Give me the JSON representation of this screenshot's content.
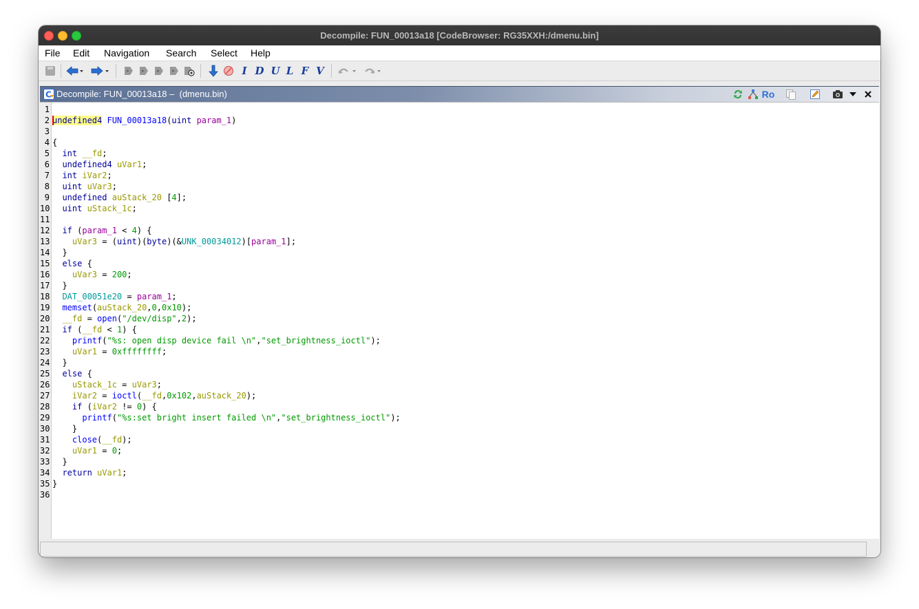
{
  "window": {
    "title": "Decompile: FUN_00013a18 [CodeBrowser: RG35XXH:/dmenu.bin]"
  },
  "menu": {
    "items": [
      "File",
      "Edit",
      "Navigation",
      "Search",
      "Select",
      "Help"
    ]
  },
  "toolbar": {
    "letters": [
      "I",
      "D",
      "U",
      "L",
      "F",
      "V"
    ]
  },
  "panel": {
    "title": "Decompile: FUN_00013a18 –  (dmenu.bin)",
    "ro_label": "Ro"
  },
  "colors": {
    "keyword": "#000099",
    "type": "#000099",
    "function": "#0000ff",
    "variable": "#999900",
    "param": "#990099",
    "global": "#009999",
    "number": "#009900",
    "string": "#009900",
    "default": "#000000"
  },
  "code": {
    "lines": [
      {
        "n": "1",
        "t": []
      },
      {
        "n": "2",
        "t": [
          {
            "s": "undefined4",
            "c": "type",
            "hl": true
          },
          {
            "s": " "
          },
          {
            "s": "FUN_00013a18",
            "c": "function"
          },
          {
            "s": "("
          },
          {
            "s": "uint",
            "c": "type"
          },
          {
            "s": " "
          },
          {
            "s": "param_1",
            "c": "param"
          },
          {
            "s": ")"
          }
        ]
      },
      {
        "n": "3",
        "t": []
      },
      {
        "n": "4",
        "t": [
          {
            "s": "{"
          }
        ]
      },
      {
        "n": "5",
        "t": [
          {
            "s": "  "
          },
          {
            "s": "int",
            "c": "type"
          },
          {
            "s": " "
          },
          {
            "s": "__fd",
            "c": "variable"
          },
          {
            "s": ";"
          }
        ]
      },
      {
        "n": "6",
        "t": [
          {
            "s": "  "
          },
          {
            "s": "undefined4",
            "c": "type"
          },
          {
            "s": " "
          },
          {
            "s": "uVar1",
            "c": "variable"
          },
          {
            "s": ";"
          }
        ]
      },
      {
        "n": "7",
        "t": [
          {
            "s": "  "
          },
          {
            "s": "int",
            "c": "type"
          },
          {
            "s": " "
          },
          {
            "s": "iVar2",
            "c": "variable"
          },
          {
            "s": ";"
          }
        ]
      },
      {
        "n": "8",
        "t": [
          {
            "s": "  "
          },
          {
            "s": "uint",
            "c": "type"
          },
          {
            "s": " "
          },
          {
            "s": "uVar3",
            "c": "variable"
          },
          {
            "s": ";"
          }
        ]
      },
      {
        "n": "9",
        "t": [
          {
            "s": "  "
          },
          {
            "s": "undefined",
            "c": "type"
          },
          {
            "s": " "
          },
          {
            "s": "auStack_20",
            "c": "variable"
          },
          {
            "s": " ["
          },
          {
            "s": "4",
            "c": "number"
          },
          {
            "s": "];"
          }
        ]
      },
      {
        "n": "10",
        "t": [
          {
            "s": "  "
          },
          {
            "s": "uint",
            "c": "type"
          },
          {
            "s": " "
          },
          {
            "s": "uStack_1c",
            "c": "variable"
          },
          {
            "s": ";"
          }
        ]
      },
      {
        "n": "11",
        "t": []
      },
      {
        "n": "12",
        "t": [
          {
            "s": "  "
          },
          {
            "s": "if",
            "c": "keyword"
          },
          {
            "s": " ("
          },
          {
            "s": "param_1",
            "c": "param"
          },
          {
            "s": " < "
          },
          {
            "s": "4",
            "c": "number"
          },
          {
            "s": ") {"
          }
        ]
      },
      {
        "n": "13",
        "t": [
          {
            "s": "    "
          },
          {
            "s": "uVar3",
            "c": "variable"
          },
          {
            "s": " = ("
          },
          {
            "s": "uint",
            "c": "type"
          },
          {
            "s": ")("
          },
          {
            "s": "byte",
            "c": "type"
          },
          {
            "s": ")(&"
          },
          {
            "s": "UNK_00034012",
            "c": "global"
          },
          {
            "s": ")["
          },
          {
            "s": "param_1",
            "c": "param"
          },
          {
            "s": "];"
          }
        ]
      },
      {
        "n": "14",
        "t": [
          {
            "s": "  }"
          }
        ]
      },
      {
        "n": "15",
        "t": [
          {
            "s": "  "
          },
          {
            "s": "else",
            "c": "keyword"
          },
          {
            "s": " {"
          }
        ]
      },
      {
        "n": "16",
        "t": [
          {
            "s": "    "
          },
          {
            "s": "uVar3",
            "c": "variable"
          },
          {
            "s": " = "
          },
          {
            "s": "200",
            "c": "number"
          },
          {
            "s": ";"
          }
        ]
      },
      {
        "n": "17",
        "t": [
          {
            "s": "  }"
          }
        ]
      },
      {
        "n": "18",
        "t": [
          {
            "s": "  "
          },
          {
            "s": "DAT_00051e20",
            "c": "global"
          },
          {
            "s": " = "
          },
          {
            "s": "param_1",
            "c": "param"
          },
          {
            "s": ";"
          }
        ]
      },
      {
        "n": "19",
        "t": [
          {
            "s": "  "
          },
          {
            "s": "memset",
            "c": "function"
          },
          {
            "s": "("
          },
          {
            "s": "auStack_20",
            "c": "variable"
          },
          {
            "s": ","
          },
          {
            "s": "0",
            "c": "number"
          },
          {
            "s": ","
          },
          {
            "s": "0x10",
            "c": "number"
          },
          {
            "s": ");"
          }
        ]
      },
      {
        "n": "20",
        "t": [
          {
            "s": "  "
          },
          {
            "s": "__fd",
            "c": "variable"
          },
          {
            "s": " = "
          },
          {
            "s": "open",
            "c": "function"
          },
          {
            "s": "("
          },
          {
            "s": "\"/dev/disp\"",
            "c": "string"
          },
          {
            "s": ","
          },
          {
            "s": "2",
            "c": "number"
          },
          {
            "s": ");"
          }
        ]
      },
      {
        "n": "21",
        "t": [
          {
            "s": "  "
          },
          {
            "s": "if",
            "c": "keyword"
          },
          {
            "s": " ("
          },
          {
            "s": "__fd",
            "c": "variable"
          },
          {
            "s": " < "
          },
          {
            "s": "1",
            "c": "number"
          },
          {
            "s": ") {"
          }
        ]
      },
      {
        "n": "22",
        "t": [
          {
            "s": "    "
          },
          {
            "s": "printf",
            "c": "function"
          },
          {
            "s": "("
          },
          {
            "s": "\"%s: open disp device fail \\n\"",
            "c": "string"
          },
          {
            "s": ","
          },
          {
            "s": "\"set_brightness_ioctl\"",
            "c": "string"
          },
          {
            "s": ");"
          }
        ]
      },
      {
        "n": "23",
        "t": [
          {
            "s": "    "
          },
          {
            "s": "uVar1",
            "c": "variable"
          },
          {
            "s": " = "
          },
          {
            "s": "0xffffffff",
            "c": "number"
          },
          {
            "s": ";"
          }
        ]
      },
      {
        "n": "24",
        "t": [
          {
            "s": "  }"
          }
        ]
      },
      {
        "n": "25",
        "t": [
          {
            "s": "  "
          },
          {
            "s": "else",
            "c": "keyword"
          },
          {
            "s": " {"
          }
        ]
      },
      {
        "n": "26",
        "t": [
          {
            "s": "    "
          },
          {
            "s": "uStack_1c",
            "c": "variable"
          },
          {
            "s": " = "
          },
          {
            "s": "uVar3",
            "c": "variable"
          },
          {
            "s": ";"
          }
        ]
      },
      {
        "n": "27",
        "t": [
          {
            "s": "    "
          },
          {
            "s": "iVar2",
            "c": "variable"
          },
          {
            "s": " = "
          },
          {
            "s": "ioctl",
            "c": "function"
          },
          {
            "s": "("
          },
          {
            "s": "__fd",
            "c": "variable"
          },
          {
            "s": ","
          },
          {
            "s": "0x102",
            "c": "number"
          },
          {
            "s": ","
          },
          {
            "s": "auStack_20",
            "c": "variable"
          },
          {
            "s": ");"
          }
        ]
      },
      {
        "n": "28",
        "t": [
          {
            "s": "    "
          },
          {
            "s": "if",
            "c": "keyword"
          },
          {
            "s": " ("
          },
          {
            "s": "iVar2",
            "c": "variable"
          },
          {
            "s": " != "
          },
          {
            "s": "0",
            "c": "number"
          },
          {
            "s": ") {"
          }
        ]
      },
      {
        "n": "29",
        "t": [
          {
            "s": "      "
          },
          {
            "s": "printf",
            "c": "function"
          },
          {
            "s": "("
          },
          {
            "s": "\"%s:set bright insert failed \\n\"",
            "c": "string"
          },
          {
            "s": ","
          },
          {
            "s": "\"set_brightness_ioctl\"",
            "c": "string"
          },
          {
            "s": ");"
          }
        ]
      },
      {
        "n": "30",
        "t": [
          {
            "s": "    }"
          }
        ]
      },
      {
        "n": "31",
        "t": [
          {
            "s": "    "
          },
          {
            "s": "close",
            "c": "function"
          },
          {
            "s": "("
          },
          {
            "s": "__fd",
            "c": "variable"
          },
          {
            "s": ");"
          }
        ]
      },
      {
        "n": "32",
        "t": [
          {
            "s": "    "
          },
          {
            "s": "uVar1",
            "c": "variable"
          },
          {
            "s": " = "
          },
          {
            "s": "0",
            "c": "number"
          },
          {
            "s": ";"
          }
        ]
      },
      {
        "n": "33",
        "t": [
          {
            "s": "  }"
          }
        ]
      },
      {
        "n": "34",
        "t": [
          {
            "s": "  "
          },
          {
            "s": "return",
            "c": "keyword"
          },
          {
            "s": " "
          },
          {
            "s": "uVar1",
            "c": "variable"
          },
          {
            "s": ";"
          }
        ]
      },
      {
        "n": "35",
        "t": [
          {
            "s": "}"
          }
        ]
      },
      {
        "n": "36",
        "t": []
      }
    ]
  }
}
